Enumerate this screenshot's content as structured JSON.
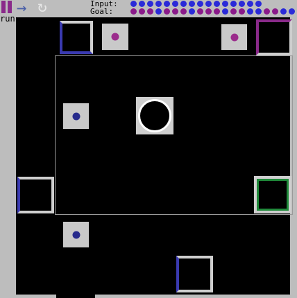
{
  "toolbar": {
    "run_label": "run",
    "pause_icon": "pause-icon",
    "step_icon": "arrow-right-icon",
    "reset_icon": "reset-icon",
    "pause_glyph": "",
    "step_glyph": "→",
    "reset_glyph": "↻"
  },
  "sequences": {
    "input_label": "Input:",
    "goal_label": "Goal:",
    "input": [
      "blue",
      "blue",
      "blue",
      "blue",
      "blue",
      "blue",
      "blue",
      "blue",
      "blue",
      "blue",
      "blue",
      "blue",
      "blue",
      "blue",
      "blue",
      "blue"
    ],
    "goal": [
      "purple",
      "purple",
      "purple",
      "blue",
      "purple",
      "purple",
      "purple",
      "blue",
      "purple",
      "purple",
      "purple",
      "blue",
      "purple",
      "purple",
      "blue",
      "blue",
      "purple",
      "purple",
      "blue",
      "blue"
    ]
  },
  "colors": {
    "blue": "#2a2ad8",
    "purple": "#8a1a8a",
    "dot_purple": "#9b2c8c",
    "dot_blue": "#262a8c",
    "green": "#1f8a3a",
    "board": "#000000",
    "frame": "#bdbdbd"
  },
  "tiles": [
    {
      "name": "box-top-left",
      "kind": "box",
      "edges": [
        "#3a3ab0",
        "#cfcfcf"
      ]
    },
    {
      "name": "purple-dot-top",
      "kind": "dot",
      "dot": "dot_purple"
    },
    {
      "name": "purple-dot-top-right",
      "kind": "dot",
      "dot": "dot_purple"
    },
    {
      "name": "box-top-right",
      "kind": "box",
      "edges": [
        "#8a2a8a",
        "#cfcfcf"
      ]
    },
    {
      "name": "blue-dot-left",
      "kind": "dot",
      "dot": "dot_blue"
    },
    {
      "name": "ball",
      "kind": "ball"
    },
    {
      "name": "box-left",
      "kind": "box"
    },
    {
      "name": "box-right-green",
      "kind": "box",
      "accent": "green"
    },
    {
      "name": "blue-dot-bottom",
      "kind": "dot",
      "dot": "dot_blue"
    },
    {
      "name": "box-bottom",
      "kind": "box"
    }
  ]
}
